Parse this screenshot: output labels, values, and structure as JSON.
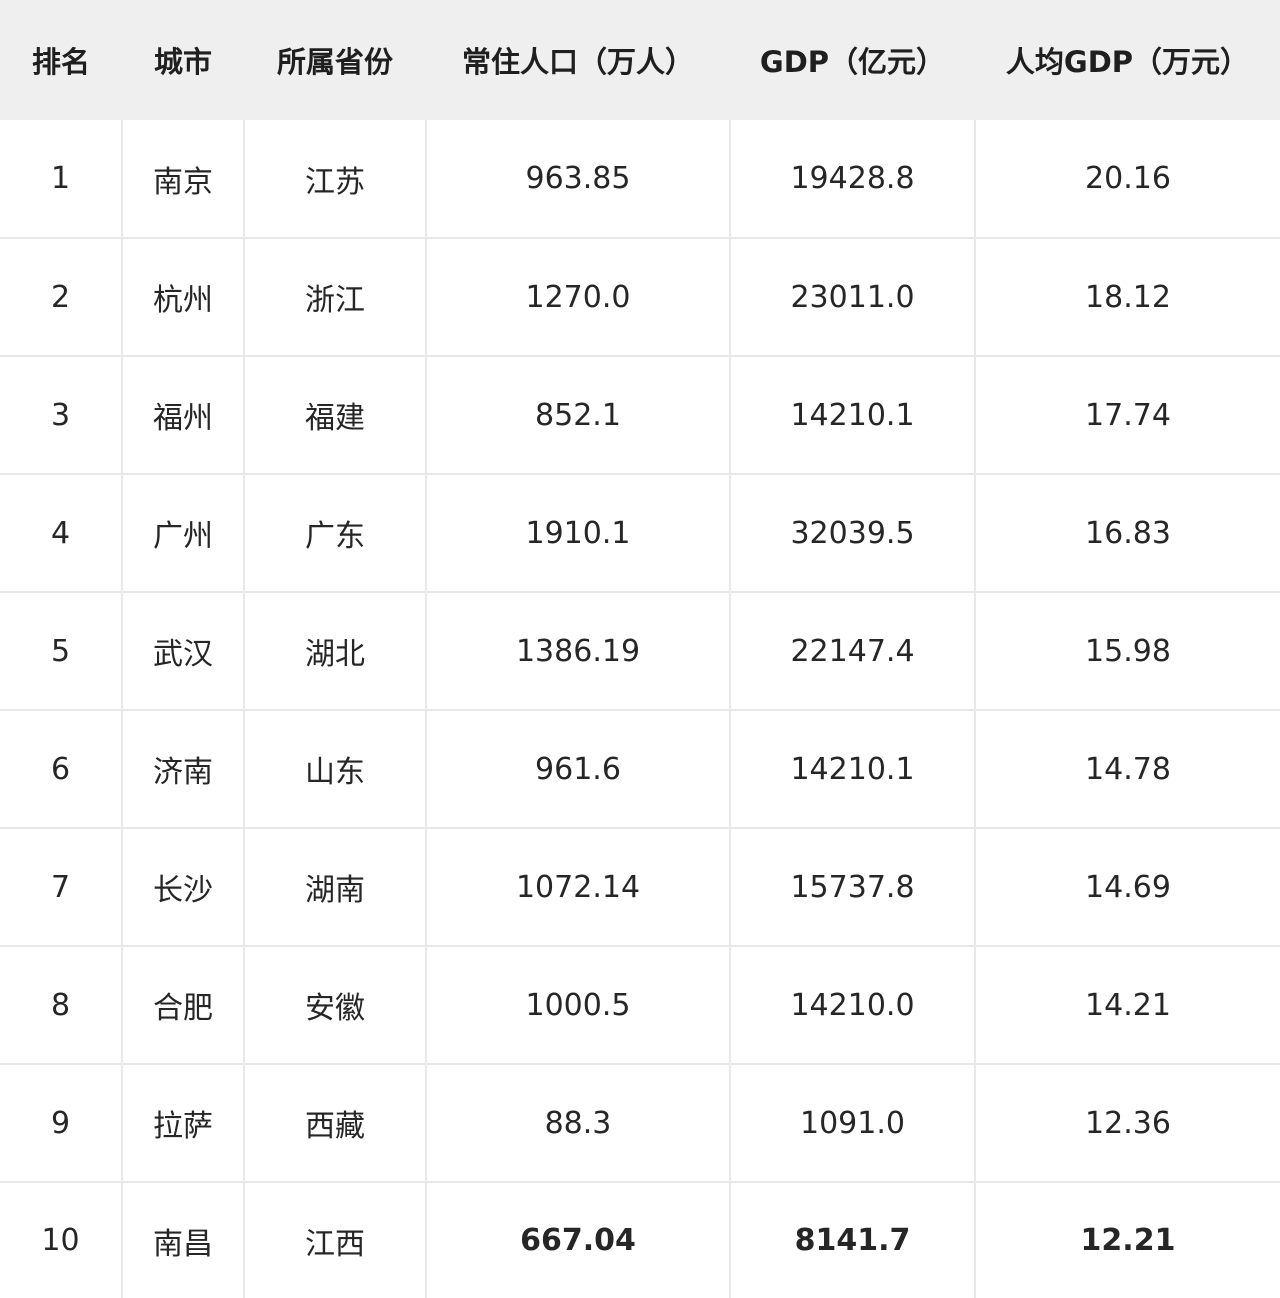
{
  "headers": {
    "rank": "排名",
    "city": "城市",
    "province": "所属省份",
    "population": "常住人口（万人）",
    "gdp": "GDP（亿元）",
    "gdp_per_capita": "人均GDP（万元）"
  },
  "rows": [
    {
      "rank": "1",
      "city": "南京",
      "province": "江苏",
      "population": "963.85",
      "gdp": "19428.8",
      "gdp_per_capita": "20.16"
    },
    {
      "rank": "2",
      "city": "杭州",
      "province": "浙江",
      "population": "1270.0",
      "gdp": "23011.0",
      "gdp_per_capita": "18.12"
    },
    {
      "rank": "3",
      "city": "福州",
      "province": "福建",
      "population": "852.1",
      "gdp": "14210.1",
      "gdp_per_capita": "17.74"
    },
    {
      "rank": "4",
      "city": "广州",
      "province": "广东",
      "population": "1910.1",
      "gdp": "32039.5",
      "gdp_per_capita": "16.83"
    },
    {
      "rank": "5",
      "city": "武汉",
      "province": "湖北",
      "population": "1386.19",
      "gdp": "22147.4",
      "gdp_per_capita": "15.98"
    },
    {
      "rank": "6",
      "city": "济南",
      "province": "山东",
      "population": "961.6",
      "gdp": "14210.1",
      "gdp_per_capita": "14.78"
    },
    {
      "rank": "7",
      "city": "长沙",
      "province": "湖南",
      "population": "1072.14",
      "gdp": "15737.8",
      "gdp_per_capita": "14.69"
    },
    {
      "rank": "8",
      "city": "合肥",
      "province": "安徽",
      "population": "1000.5",
      "gdp": "14210.0",
      "gdp_per_capita": "14.21"
    },
    {
      "rank": "9",
      "city": "拉萨",
      "province": "西藏",
      "population": "88.3",
      "gdp": "1091.0",
      "gdp_per_capita": "12.36"
    },
    {
      "rank": "10",
      "city": "南昌",
      "province": "江西",
      "population": "667.04",
      "gdp": "8141.7",
      "gdp_per_capita": "12.21"
    }
  ]
}
